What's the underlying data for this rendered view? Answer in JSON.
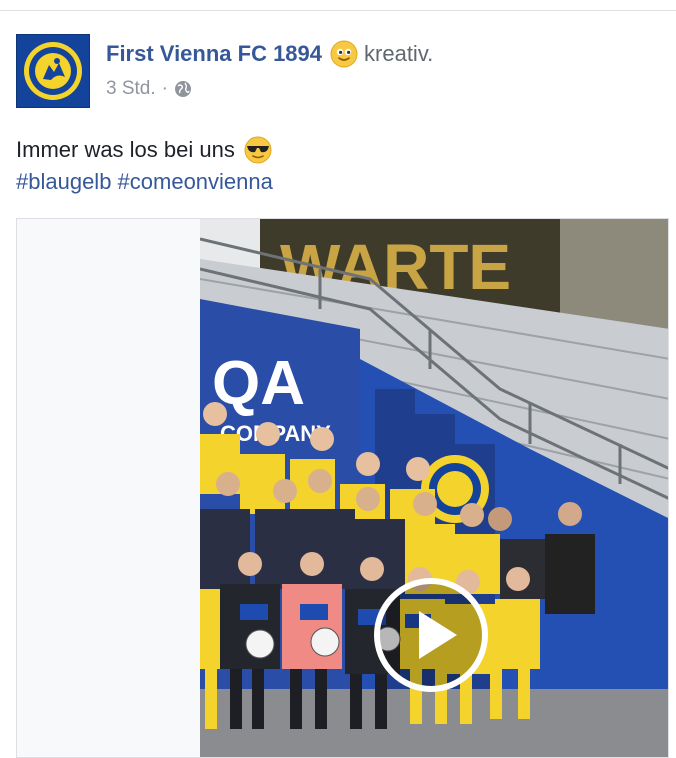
{
  "post": {
    "page_name": "First Vienna FC 1894",
    "feeling": "kreativ.",
    "feeling_icon": "smiling-face-emoji",
    "timestamp": "3 Std.",
    "separator": "·",
    "audience_icon": "globe-icon",
    "text": "Immer was los bei uns",
    "text_emoji": "cool-sunglasses-emoji",
    "hashtags": "#blaugelb #comeonvienna"
  },
  "media": {
    "type": "video",
    "banner_words": [
      "WARTE",
      "QA",
      "COMPANY",
      "UNIQA"
    ],
    "play_icon": "play-icon"
  },
  "colors": {
    "link": "#365899",
    "meta": "#90949c",
    "text": "#1d2129",
    "club_blue": "#13439a",
    "club_yellow": "#f3d32c"
  }
}
